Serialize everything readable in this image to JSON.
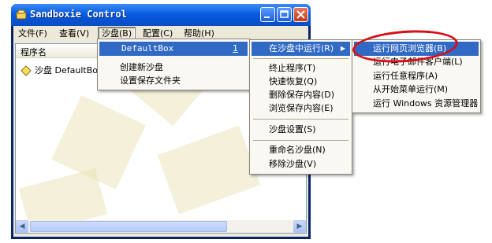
{
  "window": {
    "title": "Sandboxie Control",
    "colors": {
      "titlebar": "#0553d4",
      "menu_highlight": "#316ac5",
      "annotation": "#d80f16"
    }
  },
  "menubar": {
    "items": [
      "文件(F)",
      "查看(V)",
      "沙盘(B)",
      "配置(C)",
      "帮助(H)"
    ]
  },
  "list": {
    "column_header": "程序名",
    "rows": [
      {
        "label": "沙盘 DefaultBox",
        "icon": "sandbox-diamond-icon"
      }
    ]
  },
  "sandbox_menu": {
    "items": [
      {
        "label": "DefaultBox",
        "shortcut": "1",
        "has_submenu": true,
        "selected": true
      },
      {
        "label": "创建新沙盘"
      },
      {
        "label": "设置保存文件夹"
      }
    ]
  },
  "box_submenu": {
    "items": [
      {
        "label": "在沙盘中运行(R)",
        "has_submenu": true,
        "selected": true
      },
      {
        "label": "终止程序(T)"
      },
      {
        "label": "快速恢复(Q)"
      },
      {
        "label": "删除保存内容(D)"
      },
      {
        "label": "浏览保存内容(E)"
      },
      {
        "label": "沙盘设置(S)"
      },
      {
        "label": "重命名沙盘(N)"
      },
      {
        "label": "移除沙盘(V)"
      }
    ]
  },
  "run_submenu": {
    "items": [
      {
        "label": "运行网页浏览器(B)",
        "selected": true
      },
      {
        "label": "运行电子邮件客户端(L)"
      },
      {
        "label": "运行任意程序(A)"
      },
      {
        "label": "从开始菜单运行(M)"
      },
      {
        "label": "运行 Windows 资源管理器"
      }
    ]
  }
}
